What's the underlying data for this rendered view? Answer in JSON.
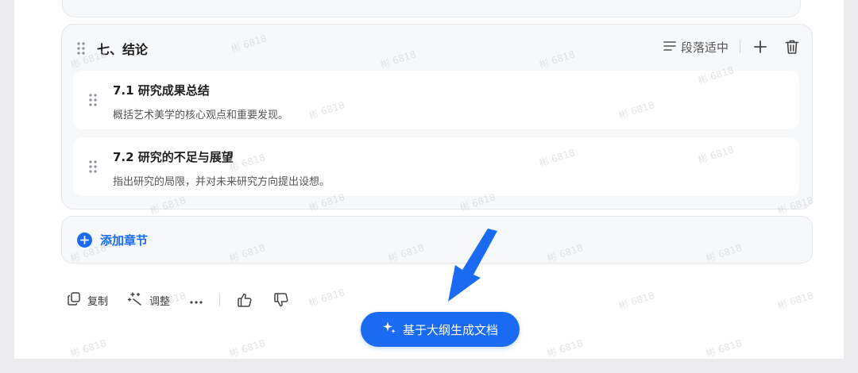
{
  "watermark_text": "彬 6818",
  "section": {
    "title": "七、结论",
    "layout_label": "段落适中",
    "items": [
      {
        "title": "7.1 研究成果总结",
        "desc": "概括艺术美学的核心观点和重要发现。"
      },
      {
        "title": "7.2 研究的不足与展望",
        "desc": "指出研究的局限，并对未来研究方向提出设想。"
      }
    ]
  },
  "add_chapter": {
    "label": "添加章节"
  },
  "actions": {
    "copy_label": "复制",
    "adjust_label": "调整"
  },
  "generate": {
    "label": "基于大纲生成文档"
  },
  "colors": {
    "accent": "#1a6bf2",
    "panel_bg": "#f7f8fa",
    "border": "#e7e8ec"
  },
  "icons": [
    "drag-handle-icon",
    "align-lines-icon",
    "plus-icon",
    "trash-icon",
    "plus-circle-icon",
    "copy-icon",
    "sparkle-magic-icon",
    "more-dots-icon",
    "thumbs-up-icon",
    "thumbs-down-icon",
    "sparkle-icon",
    "arrow-pointer"
  ]
}
